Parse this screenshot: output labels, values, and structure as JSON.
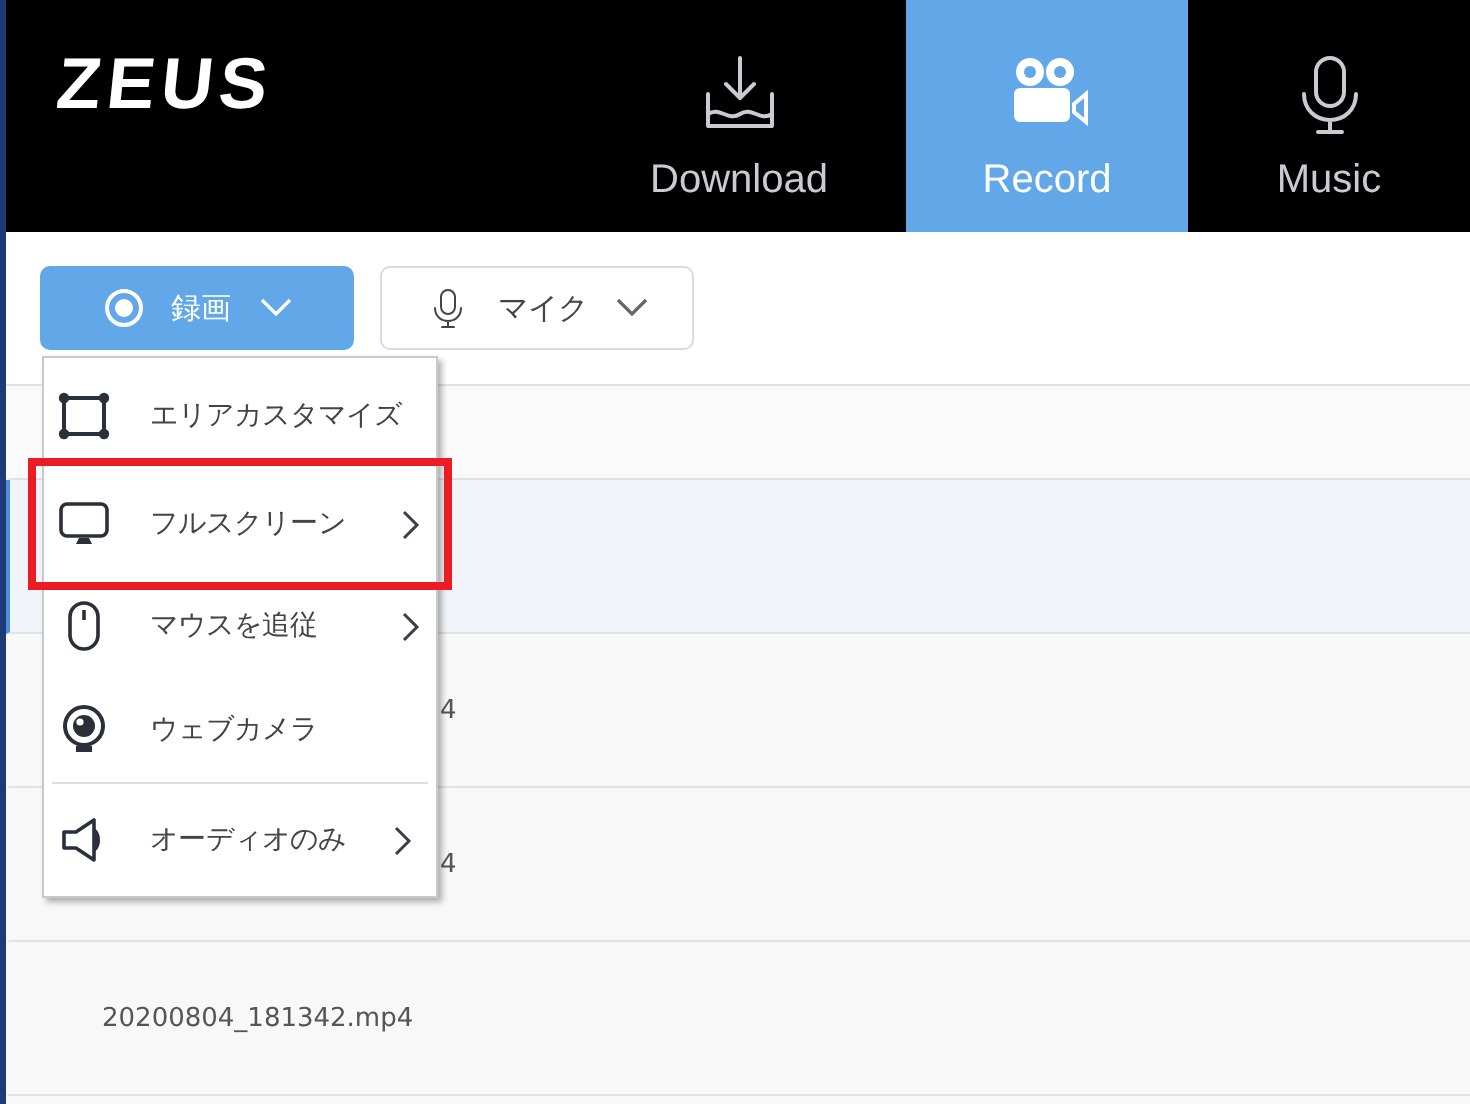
{
  "logo": "ZEUS",
  "nav": [
    {
      "label": "Download",
      "selected": false
    },
    {
      "label": "Record",
      "selected": true
    },
    {
      "label": "Music",
      "selected": false
    }
  ],
  "toolbar": [
    {
      "label": "録画",
      "primary": true
    },
    {
      "label": "マイク",
      "primary": false
    }
  ],
  "rows": [
    {
      "selected": false
    },
    {
      "selected": true
    },
    {
      "name": "4",
      "selected": false,
      "covered": true
    },
    {
      "name": "4",
      "selected": false,
      "covered": true
    },
    {
      "name": "20200804_181342.mp4",
      "selected": false,
      "covered": false
    }
  ],
  "menu": [
    {
      "label": "エリアカスタマイズ",
      "submenu": false,
      "highlighted": false,
      "divider_before": false
    },
    {
      "label": "フルスクリーン",
      "submenu": true,
      "highlighted": true,
      "divider_before": false
    },
    {
      "label": "マウスを追従",
      "submenu": true,
      "highlighted": false,
      "divider_before": false
    },
    {
      "label": "ウェブカメラ",
      "submenu": false,
      "highlighted": false,
      "divider_before": false
    },
    {
      "label": "オーディオのみ",
      "submenu": true,
      "highlighted": false,
      "divider_before": true
    }
  ]
}
